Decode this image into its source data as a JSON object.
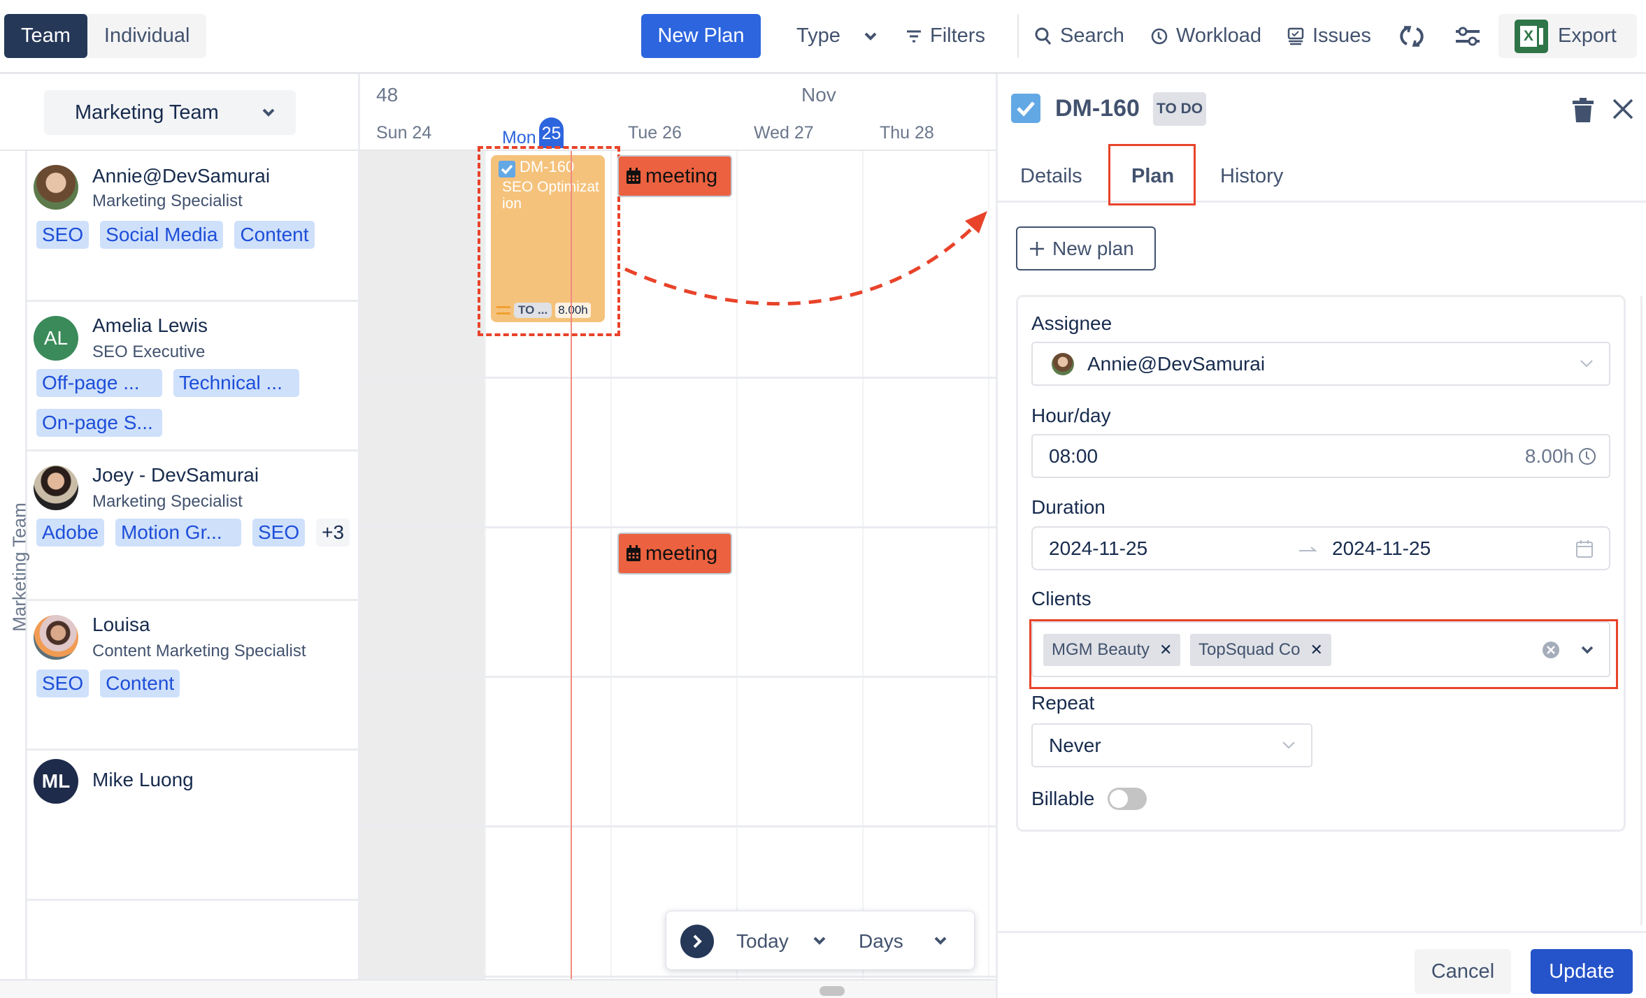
{
  "toolbar": {
    "view_toggle": [
      {
        "label": "Team",
        "active": true
      },
      {
        "label": "Individual",
        "active": false
      }
    ],
    "new_plan_label": "New Plan",
    "type_label": "Type",
    "filters_label": "Filters",
    "search_label": "Search",
    "workload_label": "Workload",
    "issues_label": "Issues",
    "export_label": "Export",
    "brand_color": "#2d65de"
  },
  "left_panel": {
    "team_select": "Marketing Team",
    "group_label": "Marketing Team",
    "members": [
      {
        "name": "Annie@DevSamurai",
        "role": "Marketing Specialist",
        "avatar": "photo",
        "tags": [
          "SEO",
          "Social Media",
          "Content"
        ],
        "more": ""
      },
      {
        "name": "Amelia Lewis",
        "role": "SEO Executive",
        "avatar": "AL",
        "avatar_color": "#3b8a5a",
        "tags": [
          "Off-page ...",
          "Technical ...",
          "On-page S..."
        ],
        "more": ""
      },
      {
        "name": "Joey - DevSamurai",
        "role": "Marketing Specialist",
        "avatar": "photo",
        "tags": [
          "Adobe",
          "Motion Gr...",
          "SEO"
        ],
        "more": "+3"
      },
      {
        "name": "Louisa",
        "role": "Content Marketing Specialist",
        "avatar": "photo",
        "tags": [
          "SEO",
          "Content"
        ],
        "more": ""
      },
      {
        "name": "Mike Luong",
        "role": "",
        "avatar": "ML",
        "avatar_color": "#1e2b4a",
        "tags": [],
        "more": ""
      }
    ]
  },
  "timeline": {
    "week_number": "48",
    "month": "Nov",
    "days": [
      {
        "label": "Sun 24",
        "today": false
      },
      {
        "label": "Mon",
        "num": "25",
        "today": true
      },
      {
        "label": "Tue 26",
        "today": false
      },
      {
        "label": "Wed 27",
        "today": false
      },
      {
        "label": "Thu 28",
        "today": false
      }
    ],
    "task": {
      "key": "DM-160",
      "title": "SEO Optimization",
      "status": "TO ...",
      "hours": "8.00h",
      "color": "#f5c27b"
    },
    "meetings": [
      {
        "label": "meeting",
        "member": "Annie@DevSamurai",
        "day": "Tue 26"
      },
      {
        "label": "meeting",
        "member": "Joey - DevSamurai",
        "day": "Tue 26"
      }
    ],
    "nav": {
      "today_label": "Today",
      "unit_label": "Days"
    }
  },
  "detail_panel": {
    "issue_key": "DM-160",
    "status": "TO DO",
    "tabs": [
      {
        "label": "Details",
        "active": false
      },
      {
        "label": "Plan",
        "active": true
      },
      {
        "label": "History",
        "active": false
      }
    ],
    "new_plan_label": "New plan",
    "form": {
      "assignee_label": "Assignee",
      "assignee_value": "Annie@DevSamurai",
      "hourday_label": "Hour/day",
      "hourday_value": "08:00",
      "hourday_total": "8.00h",
      "duration_label": "Duration",
      "duration_start": "2024-11-25",
      "duration_end": "2024-11-25",
      "clients_label": "Clients",
      "clients": [
        "MGM Beauty",
        "TopSquad Co"
      ],
      "repeat_label": "Repeat",
      "repeat_value": "Never",
      "billable_label": "Billable",
      "billable": false
    },
    "cancel_label": "Cancel",
    "update_label": "Update"
  }
}
